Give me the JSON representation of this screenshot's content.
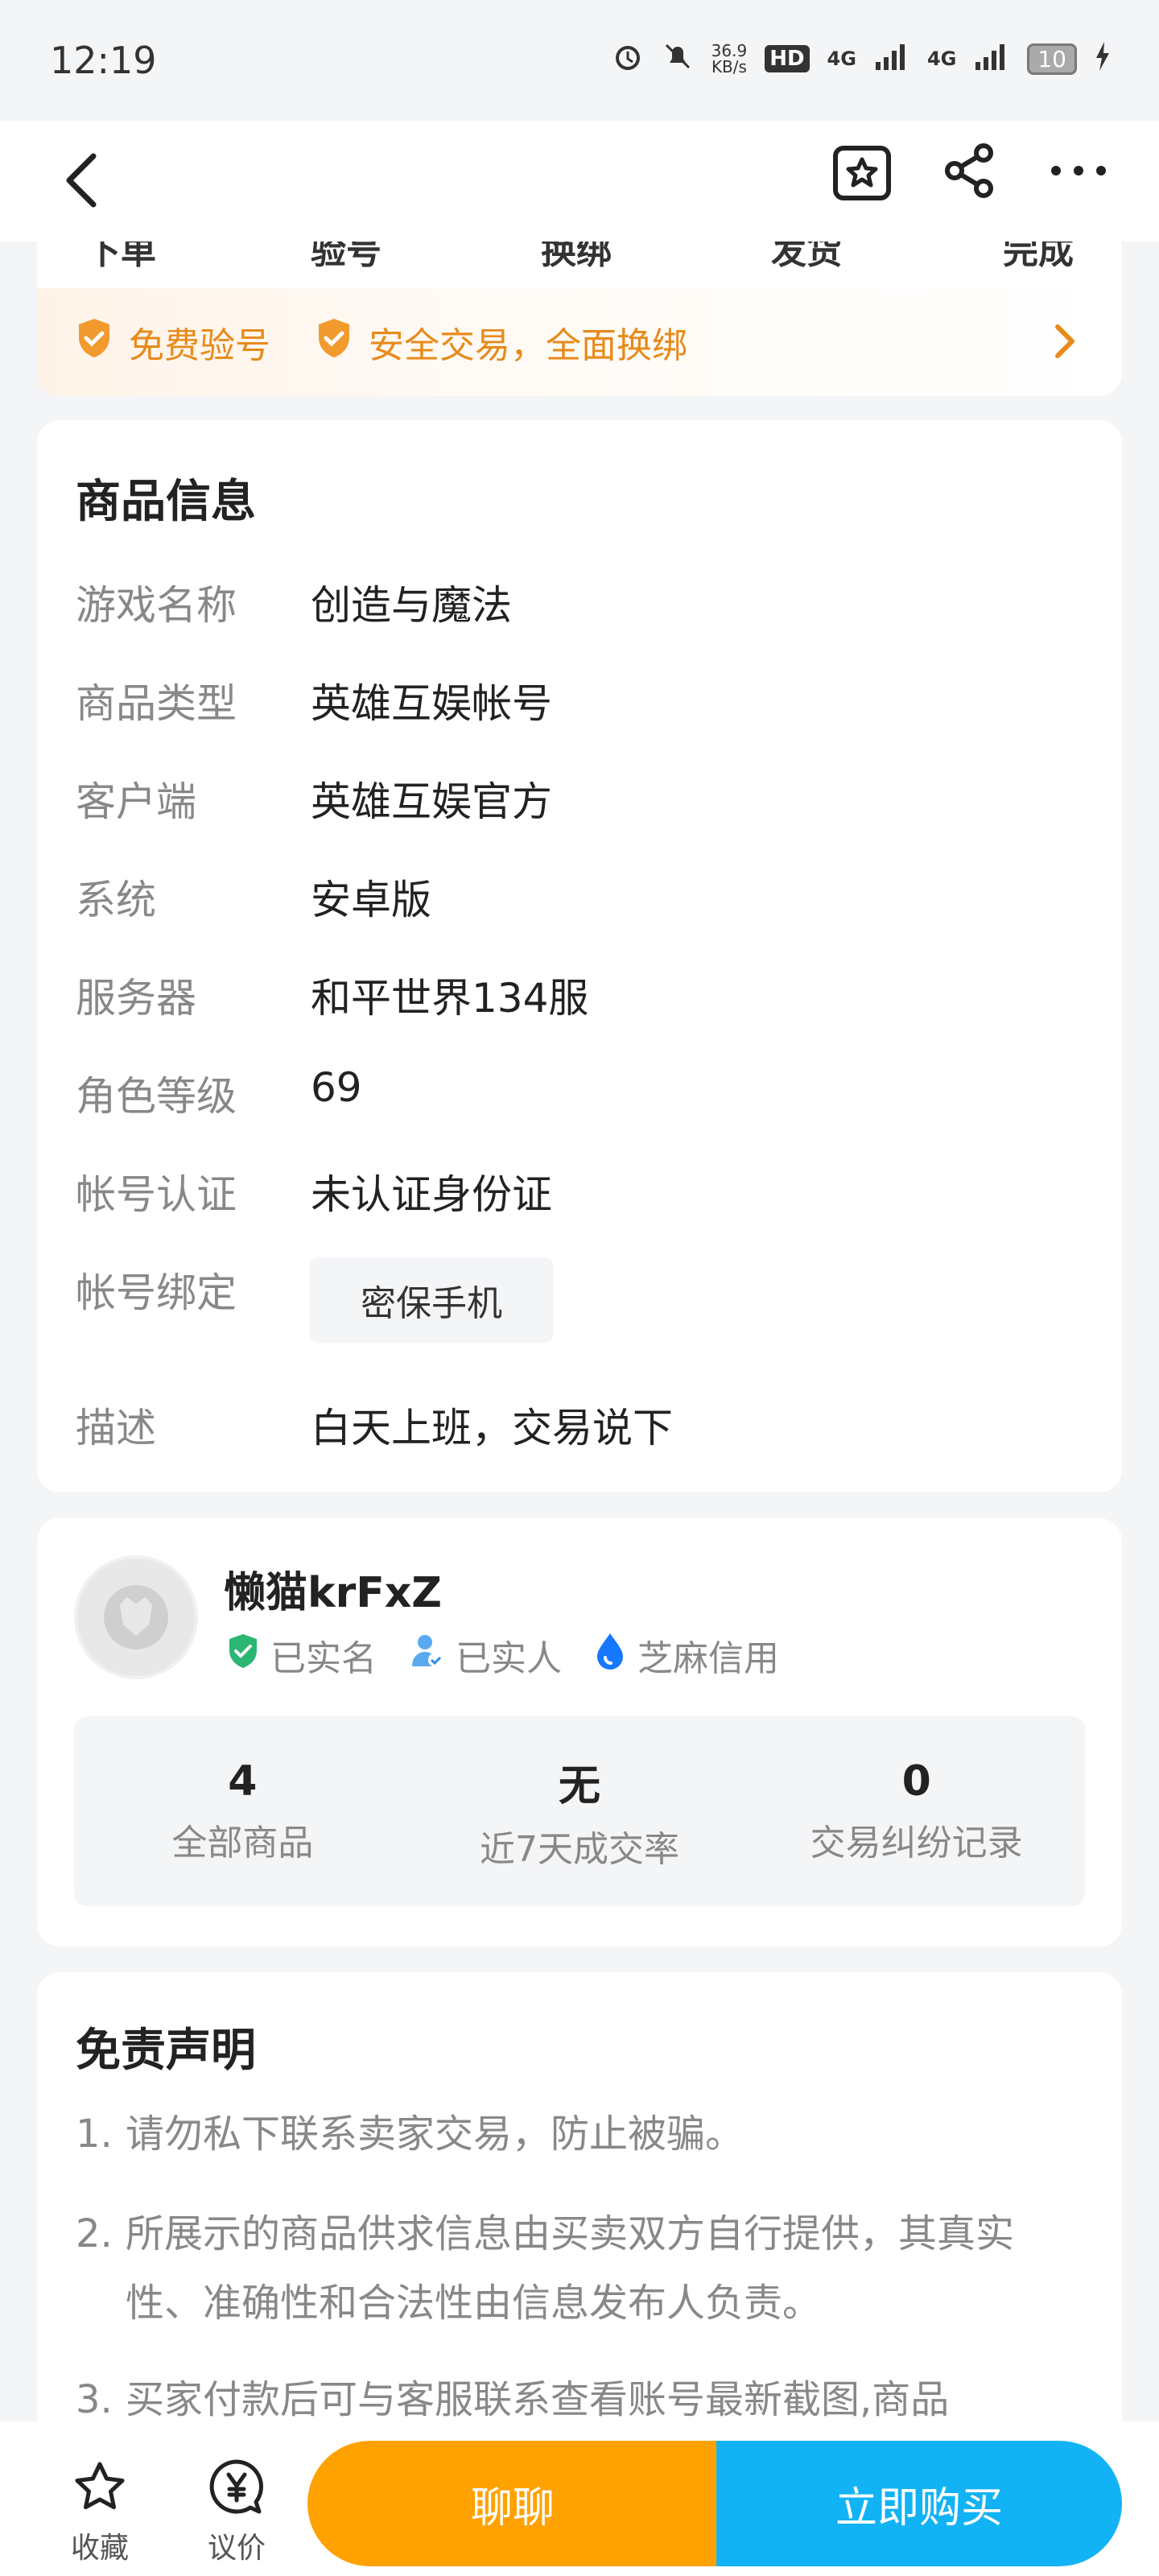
{
  "status_bar": {
    "time": "12:19",
    "speed_value": "36.9",
    "speed_unit": "KB/s",
    "hd": "HD",
    "network1": "4G",
    "network2": "4G",
    "battery": "10"
  },
  "guarantee": {
    "item1": "免费验号",
    "item2": "安全交易，全面换绑"
  },
  "product_info": {
    "title": "商品信息",
    "rows": [
      {
        "label": "游戏名称",
        "value": "创造与魔法"
      },
      {
        "label": "商品类型",
        "value": "英雄互娱帐号"
      },
      {
        "label": "客户端",
        "value": "英雄互娱官方"
      },
      {
        "label": "系统",
        "value": "安卓版"
      },
      {
        "label": "服务器",
        "value": "和平世界134服"
      },
      {
        "label": "角色等级",
        "value": "69"
      },
      {
        "label": "帐号认证",
        "value": "未认证身份证"
      },
      {
        "label": "帐号绑定",
        "value": "密保手机"
      },
      {
        "label": "描述",
        "value": "白天上班，交易说下"
      }
    ]
  },
  "seller": {
    "name": "懒猫krFxZ",
    "badges": [
      "已实名",
      "已实人",
      "芝麻信用"
    ],
    "stats": [
      {
        "num": "4",
        "label": "全部商品"
      },
      {
        "num": "无",
        "label": "近7天成交率"
      },
      {
        "num": "0",
        "label": "交易纠纷记录"
      }
    ]
  },
  "disclaimer": {
    "title": "免责声明",
    "items": [
      {
        "num": "1.",
        "text": "请勿私下联系卖家交易，防止被骗。"
      },
      {
        "num": "2.",
        "text": "所展示的商品供求信息由买卖双方自行提供，其真实性、准确性和合法性由信息发布人负责。"
      },
      {
        "num": "3.",
        "text": "买家付款后可与客服联系查看账号最新截图,商品"
      }
    ]
  },
  "bottom_bar": {
    "favorite": "收藏",
    "bargain": "议价",
    "chat": "聊聊",
    "buy": "立即购买"
  },
  "colors": {
    "accent_orange": "#ffa200",
    "accent_blue": "#12b3f5",
    "guarantee_orange": "#e88a1a"
  }
}
